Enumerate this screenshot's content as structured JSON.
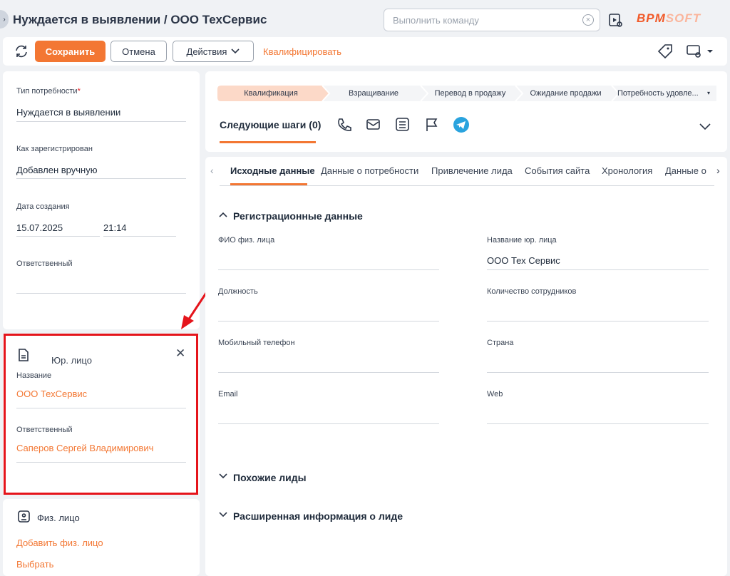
{
  "header": {
    "title": "Нуждается в выявлении / ООО ТехСервис",
    "command_placeholder": "Выполнить команду",
    "logo_main": "BPM",
    "logo_accent": "SOFT"
  },
  "toolbar": {
    "save": "Сохранить",
    "cancel": "Отмена",
    "actions": "Действия",
    "qualify": "Квалифицировать"
  },
  "left": {
    "need_type_label": "Тип потребности",
    "need_type_value": "Нуждается в выявлении",
    "registered_label": "Как зарегистрирован",
    "registered_value": "Добавлен вручную",
    "created_label": "Дата создания",
    "created_date": "15.07.2025",
    "created_time": "21:14",
    "owner_label": "Ответственный",
    "owner_value": ""
  },
  "legal": {
    "title": "Юр. лицо",
    "name_label": "Название",
    "name_value": "ООО ТехСервис",
    "owner_label": "Ответственный",
    "owner_value": "Саперов Сергей Владимирович"
  },
  "person": {
    "title": "Физ. лицо",
    "add": "Добавить физ. лицо",
    "select": "Выбрать"
  },
  "stages": [
    "Квалификация",
    "Взращивание",
    "Перевод в продажу",
    "Ожидание продажи",
    "Потребность удовле..."
  ],
  "next_steps": "Следующие шаги (0)",
  "tabs": [
    "Исходные данные",
    "Данные о потребности",
    "Привлечение лида",
    "События сайта",
    "Хронология",
    "Данные о"
  ],
  "reg": {
    "title": "Регистрационные данные",
    "fio": "ФИО физ. лица",
    "fio_value": "",
    "company": "Название юр. лица",
    "company_value": "ООО Тех Сервис",
    "position": "Должность",
    "employees": "Количество сотрудников",
    "mobile": "Мобильный телефон",
    "country": "Страна",
    "email": "Email",
    "web": "Web"
  },
  "sections": {
    "similar": "Похожие лиды",
    "extended": "Расширенная информация о лиде"
  },
  "colors": {
    "accent": "#f37733",
    "highlight": "#e5141b",
    "telegram": "#2aa3de"
  }
}
